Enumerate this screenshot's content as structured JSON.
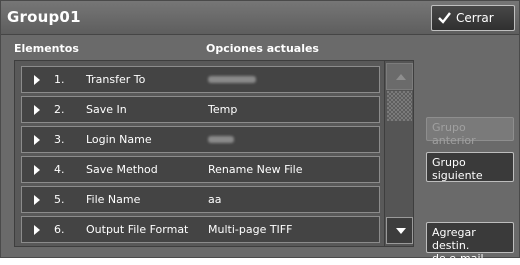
{
  "window": {
    "title": "Group01"
  },
  "close_button": {
    "label": "Cerrar",
    "icon": "check-icon"
  },
  "columns": {
    "items": "Elementos",
    "current_options": "Opciones actuales"
  },
  "rows": [
    {
      "number": "1.",
      "name": "Transfer To",
      "value": "",
      "value_obscured": true
    },
    {
      "number": "2.",
      "name": "Save In",
      "value": "Temp"
    },
    {
      "number": "3.",
      "name": "Login Name",
      "value": "",
      "value_obscured": true
    },
    {
      "number": "4.",
      "name": "Save Method",
      "value": "Rename New File"
    },
    {
      "number": "5.",
      "name": "File Name",
      "value": "aa"
    },
    {
      "number": "6.",
      "name": "Output File Format",
      "value": "Multi-page TIFF"
    }
  ],
  "side_buttons": {
    "previous_group": "Grupo anterior",
    "next_group_line1": "Grupo",
    "next_group_line2": "siguiente",
    "add_email_line1": "Agregar destin.",
    "add_email_line2": "de e-mail"
  },
  "colors": {
    "background": "#6a6a6a",
    "row": "#444444",
    "text": "#ffffff"
  }
}
